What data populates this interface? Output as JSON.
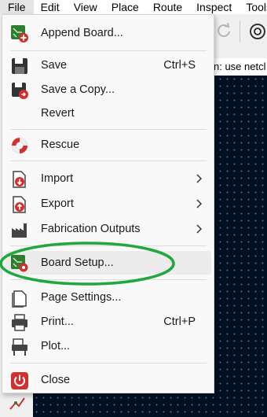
{
  "menubar": {
    "items": [
      "File",
      "Edit",
      "View",
      "Place",
      "Route",
      "Inspect",
      "Tools"
    ]
  },
  "hint_bar": {
    "text": "n: use netcl"
  },
  "file_menu": {
    "items": [
      {
        "label": "Append Board...",
        "icon": "append-board-icon"
      },
      {
        "label": "Save",
        "shortcut": "Ctrl+S",
        "icon": "save-icon"
      },
      {
        "label": "Save a Copy...",
        "icon": "save-copy-icon"
      },
      {
        "label": "Revert"
      },
      {
        "label": "Rescue",
        "icon": "rescue-icon"
      },
      {
        "label": "Import",
        "icon": "import-icon",
        "submenu": true
      },
      {
        "label": "Export",
        "icon": "export-icon",
        "submenu": true
      },
      {
        "label": "Fabrication Outputs",
        "icon": "fabrication-icon",
        "submenu": true
      },
      {
        "label": "Board Setup...",
        "icon": "board-setup-icon",
        "highlighted": true
      },
      {
        "label": "Page Settings...",
        "icon": "page-settings-icon"
      },
      {
        "label": "Print...",
        "shortcut": "Ctrl+P",
        "icon": "printer-icon"
      },
      {
        "label": "Plot...",
        "icon": "plotter-icon"
      },
      {
        "label": "Close",
        "icon": "power-icon"
      }
    ]
  },
  "colors": {
    "annotation_ellipse": "#21a83c",
    "canvas": "#001023",
    "icon_green": "#2e7d32",
    "icon_red": "#d32f2f"
  }
}
